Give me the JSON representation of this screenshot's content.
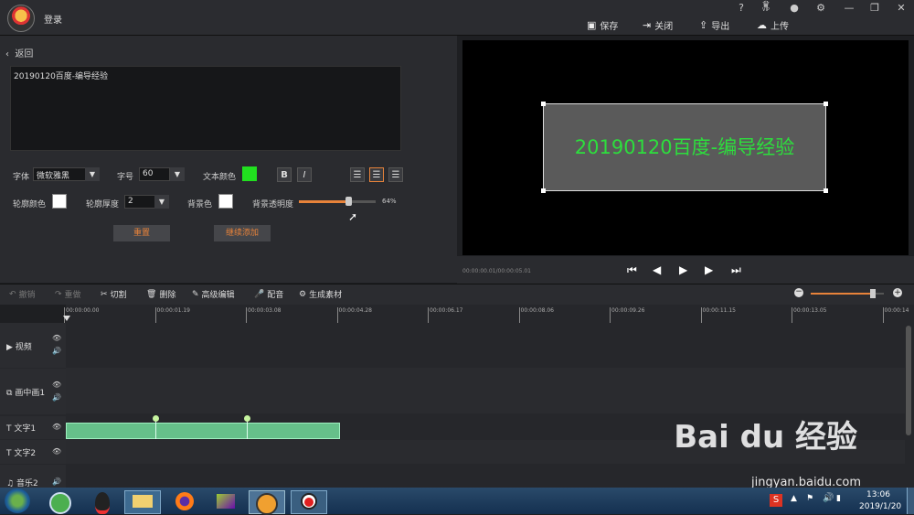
{
  "topbar": {
    "login": "登录",
    "window_icons": [
      "help-icon",
      "vip-icon",
      "bell-icon",
      "gear-icon",
      "minimize-icon",
      "restore-icon",
      "close-icon"
    ],
    "window_glyphs": [
      "?",
      "♛",
      "●",
      "⚙",
      "—",
      "❐",
      "✕"
    ],
    "actions": [
      {
        "label": "保存",
        "icon": "save-icon",
        "glyph": "▣"
      },
      {
        "label": "关闭",
        "icon": "exit-icon",
        "glyph": "⇥"
      },
      {
        "label": "导出",
        "icon": "export-icon",
        "glyph": "⇪"
      },
      {
        "label": "上传",
        "icon": "cloud-upload-icon",
        "glyph": "☁"
      }
    ],
    "vip_label": "VIP"
  },
  "editor": {
    "back": "返回",
    "text_value": "20190120百度-编导经验",
    "font_label": "字体",
    "font_value": "微软雅黑",
    "size_label": "字号",
    "size_value": "60",
    "text_color_label": "文本颜色",
    "text_color": "#21e01f",
    "bold": "B",
    "italic": "I",
    "outline_color_label": "轮廓颜色",
    "outline_color": "#ffffff",
    "outline_thickness_label": "轮廓厚度",
    "outline_thickness_value": "2",
    "bg_color_label": "背景色",
    "bg_color": "#ffffff",
    "bg_opacity_label": "背景透明度",
    "bg_opacity_value": "64%",
    "bg_opacity_fraction": 0.64,
    "reset": "重置",
    "continue_add": "继续添加"
  },
  "preview": {
    "text": "20190120百度-编导经验",
    "time": "00:00:00.01/00:00:05.01"
  },
  "toolbar": {
    "undo": "撤销",
    "redo": "重做",
    "cut": "切割",
    "delete": "删除",
    "advanced": "高级编辑",
    "dub": "配音",
    "generate": "生成素材",
    "zoom_fraction": 0.85
  },
  "ruler": [
    "00:00:00.00",
    "00:00:01.19",
    "00:00:03.08",
    "00:00:04.28",
    "00:00:06.17",
    "00:00:08.06",
    "00:00:09.26",
    "00:00:11.15",
    "00:00:13.05",
    "00:00:14"
  ],
  "tracks": [
    {
      "label": "视频",
      "icon": "video-icon",
      "glyph": "▶"
    },
    {
      "label": "画中画1",
      "icon": "pip-icon",
      "glyph": "⧉"
    },
    {
      "label": "文字1",
      "icon": "text-icon",
      "glyph": "T"
    },
    {
      "label": "文字2",
      "icon": "text-icon",
      "glyph": "T"
    },
    {
      "label": "音乐2",
      "icon": "music-icon",
      "glyph": "♫"
    }
  ],
  "taskbar": {
    "time": "13:06",
    "date": "2019/1/20"
  },
  "watermark": {
    "brand": "Bai du 经验",
    "url": "jingyan.baidu.com"
  }
}
